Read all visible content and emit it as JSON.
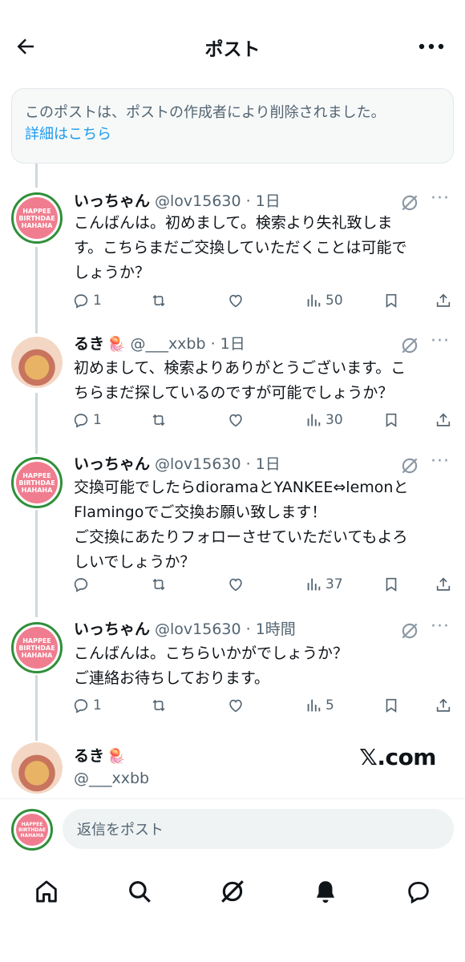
{
  "header": {
    "title": "ポスト",
    "back_icon": "arrow-left-icon",
    "more_icon": "more-horizontal-icon"
  },
  "notice": {
    "text": "このポストは、ポストの作成者により削除されました。",
    "link": "詳細はこちら"
  },
  "posts": [
    {
      "name": "いっちゃん",
      "meta": "@lov15630 · 1日",
      "text": "こんばんは。初めまして。検索より失礼致しま\nす。こちらまだご交換していただくことは可能で\nしょうか？",
      "replies": "1",
      "retweets": "",
      "likes": "",
      "views": "50"
    },
    {
      "name": "るき",
      "badge": "🪼",
      "meta": "@___xxbb · 1日",
      "text": "初めまして、検索よりありがとうございます。こ\nちらまだ探しているのですが可能でしょうか？",
      "replies": "1",
      "retweets": "",
      "likes": "",
      "views": "30"
    },
    {
      "name": "いっちゃん",
      "meta": "@lov15630 · 1日",
      "text": "交換可能でしたらdioramaとYANKEE⇔lemonと\nFlamingoでご交換お願い致します！\nご交換にあたりフォローさせていただいてもよろ\nしいでしょうか？",
      "replies": "",
      "retweets": "",
      "likes": "",
      "views": "37"
    },
    {
      "name": "いっちゃん",
      "meta": "@lov15630 · 1時間",
      "text": "こんばんは。こちらいかがでしょうか？\nご連絡お待ちしております。",
      "replies": "1",
      "retweets": "",
      "likes": "",
      "views": "5"
    }
  ],
  "last_post": {
    "name": "るき",
    "badge": "🪼",
    "handle": "@___xxbb",
    "watermark": "𝕏.com"
  },
  "avatar_text": "HAPPEE BIRTHDAE HAHAHA",
  "reply_bar": {
    "placeholder": "返信をポスト"
  },
  "nav": [
    "home-icon",
    "search-icon",
    "grok-icon",
    "notifications-icon",
    "messages-icon"
  ],
  "colors": {
    "accent": "#1d9bf0",
    "secondary_text": "#536471"
  }
}
